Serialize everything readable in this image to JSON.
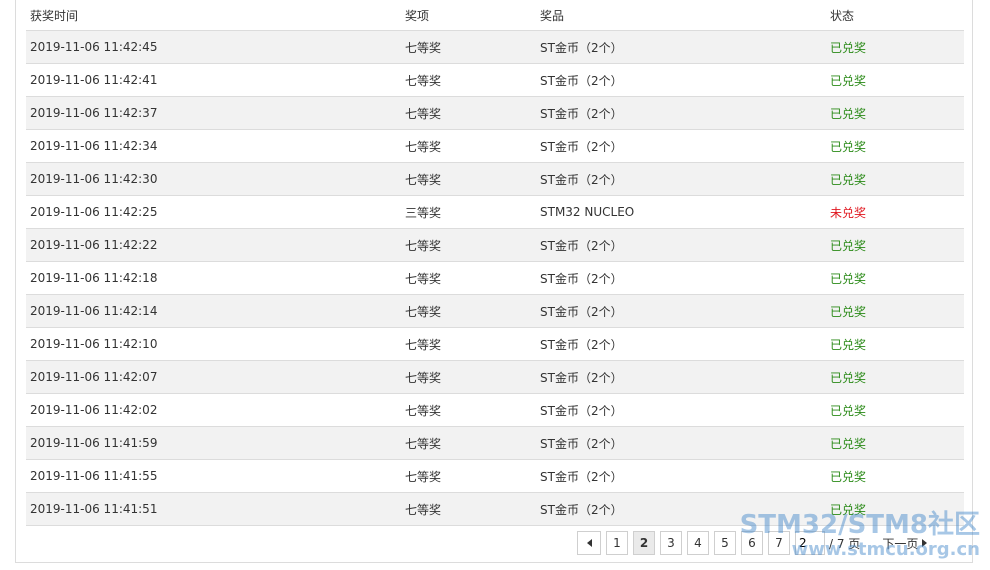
{
  "table": {
    "headers": [
      "获奖时间",
      "奖项",
      "奖品",
      "状态"
    ],
    "rows": [
      {
        "time": "2019-11-06 11:42:45",
        "prize_level": "七等奖",
        "prize": "ST金币（2个）",
        "status": "已兑奖"
      },
      {
        "time": "2019-11-06 11:42:41",
        "prize_level": "七等奖",
        "prize": "ST金币（2个）",
        "status": "已兑奖"
      },
      {
        "time": "2019-11-06 11:42:37",
        "prize_level": "七等奖",
        "prize": "ST金币（2个）",
        "status": "已兑奖"
      },
      {
        "time": "2019-11-06 11:42:34",
        "prize_level": "七等奖",
        "prize": "ST金币（2个）",
        "status": "已兑奖"
      },
      {
        "time": "2019-11-06 11:42:30",
        "prize_level": "七等奖",
        "prize": "ST金币（2个）",
        "status": "已兑奖"
      },
      {
        "time": "2019-11-06 11:42:25",
        "prize_level": "三等奖",
        "prize": "STM32 NUCLEO",
        "status": "未兑奖"
      },
      {
        "time": "2019-11-06 11:42:22",
        "prize_level": "七等奖",
        "prize": "ST金币（2个）",
        "status": "已兑奖"
      },
      {
        "time": "2019-11-06 11:42:18",
        "prize_level": "七等奖",
        "prize": "ST金币（2个）",
        "status": "已兑奖"
      },
      {
        "time": "2019-11-06 11:42:14",
        "prize_level": "七等奖",
        "prize": "ST金币（2个）",
        "status": "已兑奖"
      },
      {
        "time": "2019-11-06 11:42:10",
        "prize_level": "七等奖",
        "prize": "ST金币（2个）",
        "status": "已兑奖"
      },
      {
        "time": "2019-11-06 11:42:07",
        "prize_level": "七等奖",
        "prize": "ST金币（2个）",
        "status": "已兑奖"
      },
      {
        "time": "2019-11-06 11:42:02",
        "prize_level": "七等奖",
        "prize": "ST金币（2个）",
        "status": "已兑奖"
      },
      {
        "time": "2019-11-06 11:41:59",
        "prize_level": "七等奖",
        "prize": "ST金币（2个）",
        "status": "已兑奖"
      },
      {
        "time": "2019-11-06 11:41:55",
        "prize_level": "七等奖",
        "prize": "ST金币（2个）",
        "status": "已兑奖"
      },
      {
        "time": "2019-11-06 11:41:51",
        "prize_level": "七等奖",
        "prize": "ST金币（2个）",
        "status": "已兑奖"
      }
    ]
  },
  "pagination": {
    "pages": [
      "1",
      "2",
      "3",
      "4",
      "5",
      "6",
      "7"
    ],
    "current_page": "2",
    "jump_value": "2",
    "total_label": "/ 7 页",
    "next_label": "下一页"
  },
  "watermark": {
    "line1": "STM32/STM8社区",
    "line2": "www.stmcu.org.cn"
  },
  "colors": {
    "status_redeemed": "#2a8a17",
    "status_unredeemed": "#e0161e",
    "row_shade": "#f2f2f2",
    "border": "#dcdcdc"
  },
  "icons": {
    "prev": "triangle-left-icon",
    "next": "triangle-right-icon"
  }
}
